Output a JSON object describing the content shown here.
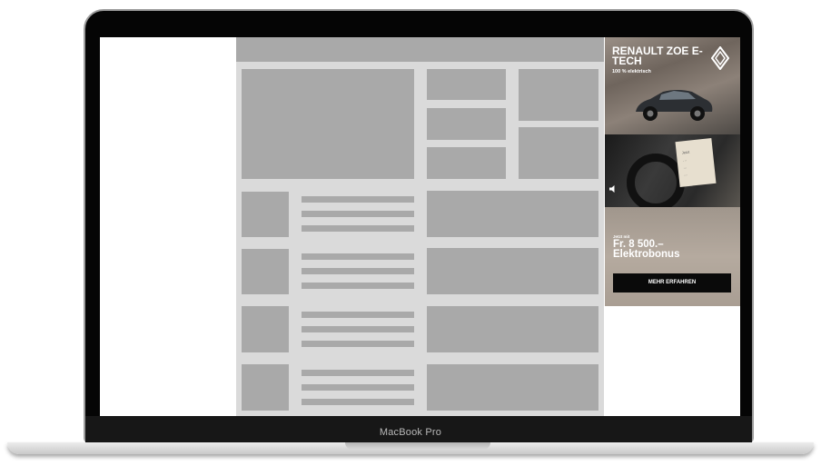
{
  "laptop": {
    "brand_label": "MacBook Pro"
  },
  "ad": {
    "headline": "RENAULT ZOE E-TECH",
    "subline": "100 % elektrisch",
    "note_lines": [
      "Jetzt",
      ". ..",
      "...",
      "..."
    ],
    "small_label": "Jetzt mit",
    "offer": "Fr. 8 500.– Elektrobonus",
    "cta_label": "MEHR ERFAHREN"
  },
  "colors": {
    "wireframe_block": "#a9a9a9",
    "wireframe_bg": "#dadada",
    "bezel": "#050505",
    "cta_bg": "#0a0a0a"
  }
}
